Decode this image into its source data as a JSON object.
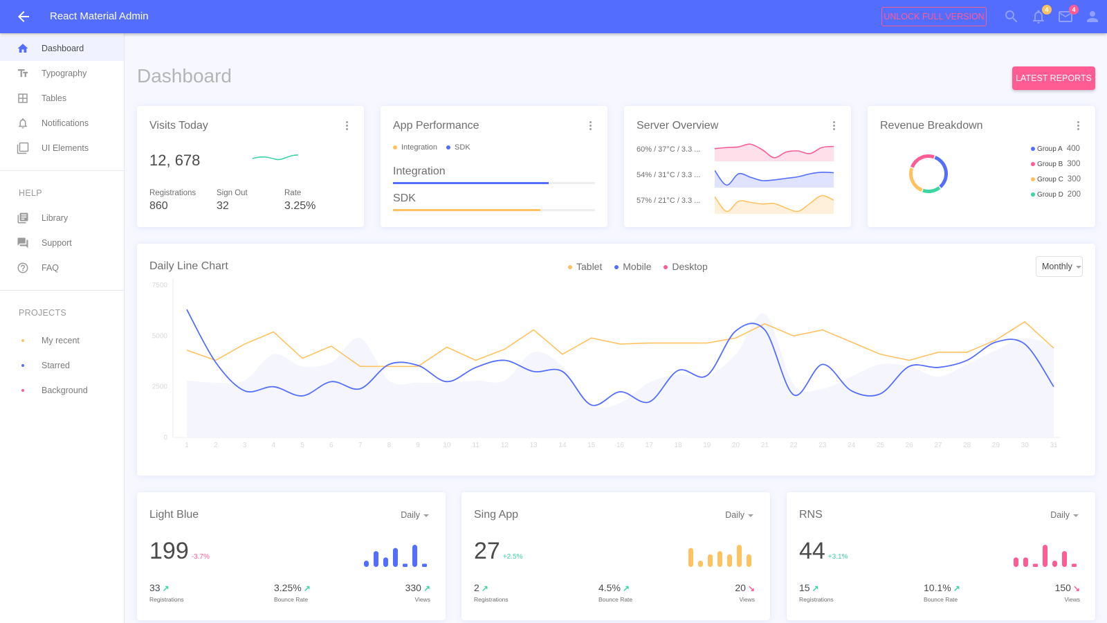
{
  "header": {
    "title": "React Material Admin",
    "unlock_label": "UNLOCK FULL VERSION",
    "notifications_count": "4",
    "messages_count": "4",
    "brand_color": "#536dfe",
    "accent_color": "#ff5c93"
  },
  "sidebar": {
    "items": [
      {
        "label": "Dashboard",
        "icon": "home-icon",
        "active": true
      },
      {
        "label": "Typography",
        "icon": "text-fields-icon"
      },
      {
        "label": "Tables",
        "icon": "table-icon"
      },
      {
        "label": "Notifications",
        "icon": "bell-icon"
      },
      {
        "label": "UI Elements",
        "icon": "layers-icon"
      }
    ],
    "help_label": "HELP",
    "help_items": [
      {
        "label": "Library",
        "icon": "library-icon"
      },
      {
        "label": "Support",
        "icon": "forum-icon"
      },
      {
        "label": "FAQ",
        "icon": "help-circle-icon"
      }
    ],
    "projects_label": "PROJECTS",
    "projects": [
      {
        "label": "My recent",
        "color": "#ffc260"
      },
      {
        "label": "Starred",
        "color": "#536dfe"
      },
      {
        "label": "Background",
        "color": "#ff5c93"
      }
    ]
  },
  "page": {
    "title": "Dashboard",
    "latest_reports_label": "LATEST REPORTS"
  },
  "visits": {
    "title": "Visits Today",
    "value": "12, 678",
    "stats": [
      {
        "label": "Registrations",
        "value": "860"
      },
      {
        "label": "Sign Out",
        "value": "32"
      },
      {
        "label": "Rate",
        "value": "3.25%"
      }
    ]
  },
  "performance": {
    "title": "App Performance",
    "legend": [
      {
        "label": "Integration",
        "color": "#ffc260"
      },
      {
        "label": "SDK",
        "color": "#536dfe"
      }
    ],
    "bars": [
      {
        "label": "Integration",
        "progress": 77,
        "color": "#536dfe"
      },
      {
        "label": "SDK",
        "progress": 73,
        "color": "#ffc260"
      }
    ]
  },
  "server": {
    "title": "Server Overview",
    "rows": [
      {
        "label": "60% / 37°C / 3.3 ...",
        "color": "#ff5c93",
        "fill": "#ffe0ea",
        "values": [
          50,
          55,
          58,
          70,
          45,
          10,
          35,
          40,
          28,
          55,
          60
        ]
      },
      {
        "label": "54% / 31°C / 3.3 ...",
        "color": "#536dfe",
        "fill": "#dfe3ff",
        "values": [
          70,
          5,
          55,
          40,
          25,
          28,
          35,
          42,
          55,
          62,
          60
        ]
      },
      {
        "label": "57% / 21°C / 3.3 ...",
        "color": "#ffc260",
        "fill": "#fff0dc",
        "values": [
          70,
          5,
          50,
          45,
          38,
          40,
          20,
          5,
          40,
          75,
          55
        ]
      }
    ]
  },
  "revenue": {
    "title": "Revenue Breakdown",
    "groups": [
      {
        "label": "Group A",
        "value": 400,
        "color": "#536dfe"
      },
      {
        "label": "Group B",
        "value": 300,
        "color": "#ff5c93"
      },
      {
        "label": "Group C",
        "value": 300,
        "color": "#ffc260"
      },
      {
        "label": "Group D",
        "value": 200,
        "color": "#3cd4a0"
      }
    ]
  },
  "daily_chart": {
    "title": "Daily Line Chart",
    "period": "Monthly",
    "legend": [
      {
        "label": "Tablet",
        "color": "#ffc260"
      },
      {
        "label": "Mobile",
        "color": "#536dfe"
      },
      {
        "label": "Desktop",
        "color": "#ff5c93"
      }
    ]
  },
  "chart_data": {
    "type": "line",
    "title": "Daily Line Chart",
    "xlabel": "",
    "ylabel": "",
    "x": [
      1,
      2,
      3,
      4,
      5,
      6,
      7,
      8,
      9,
      10,
      11,
      12,
      13,
      14,
      15,
      16,
      17,
      18,
      19,
      20,
      21,
      22,
      23,
      24,
      25,
      26,
      27,
      28,
      29,
      30,
      31
    ],
    "ylim": [
      0,
      7500
    ],
    "yticks": [
      0,
      2500,
      5000,
      7500
    ],
    "series": [
      {
        "name": "Tablet",
        "color": "#ffc260",
        "values": [
          4300,
          3800,
          4600,
          5200,
          3900,
          4500,
          3500,
          3500,
          3500,
          4450,
          3800,
          4350,
          5300,
          4100,
          4900,
          4600,
          4650,
          4650,
          4650,
          4900,
          5600,
          5000,
          5300,
          4700,
          4100,
          3800,
          4200,
          4200,
          4800,
          5700,
          4400
        ]
      },
      {
        "name": "Mobile",
        "color": "#536dfe",
        "values": [
          6300,
          3700,
          2300,
          2500,
          2050,
          2750,
          2400,
          3600,
          3550,
          2750,
          3450,
          3800,
          3250,
          3250,
          1600,
          2250,
          1750,
          3300,
          3050,
          5250,
          5300,
          2100,
          3600,
          2300,
          2150,
          3500,
          3450,
          3800,
          4700,
          4600,
          2500
        ]
      },
      {
        "name": "Desktop",
        "color": "#f0f2fc",
        "values": [
          2800,
          2700,
          2800,
          4100,
          3500,
          3700,
          4900,
          2800,
          2700,
          2700,
          2800,
          2800,
          4200,
          3500,
          1600,
          1700,
          2700,
          3100,
          3000,
          4100,
          6100,
          2600,
          2400,
          3000,
          3600,
          3500,
          3000,
          3600,
          4300,
          4900,
          4500
        ]
      }
    ]
  },
  "small_cards": [
    {
      "title": "Light Blue",
      "period": "Daily",
      "value": "199",
      "change": "-3.7%",
      "change_dir": "down",
      "color": "#536dfe",
      "bars": [
        2,
        5,
        3,
        6,
        1,
        7,
        1
      ],
      "stats": [
        {
          "value": "33",
          "label": "Registrations",
          "trend": "up"
        },
        {
          "value": "3.25%",
          "label": "Bounce Rate",
          "trend": "up"
        },
        {
          "value": "330",
          "label": "Views",
          "trend": "up"
        }
      ]
    },
    {
      "title": "Sing App",
      "period": "Daily",
      "value": "27",
      "change": "+2.5%",
      "change_dir": "up",
      "color": "#ffc260",
      "bars": [
        6,
        2,
        4,
        5,
        4,
        7,
        4
      ],
      "stats": [
        {
          "value": "2",
          "label": "Registrations",
          "trend": "up"
        },
        {
          "value": "4.5%",
          "label": "Bounce Rate",
          "trend": "up"
        },
        {
          "value": "20",
          "label": "Views",
          "trend": "down"
        }
      ]
    },
    {
      "title": "RNS",
      "period": "Daily",
      "value": "44",
      "change": "+3.1%",
      "change_dir": "up",
      "color": "#ff5c93",
      "bars": [
        3,
        3,
        1,
        7,
        2,
        5,
        1
      ],
      "stats": [
        {
          "value": "15",
          "label": "Registrations",
          "trend": "up"
        },
        {
          "value": "10.1%",
          "label": "Bounce Rate",
          "trend": "up"
        },
        {
          "value": "150",
          "label": "Views",
          "trend": "down"
        }
      ]
    }
  ]
}
